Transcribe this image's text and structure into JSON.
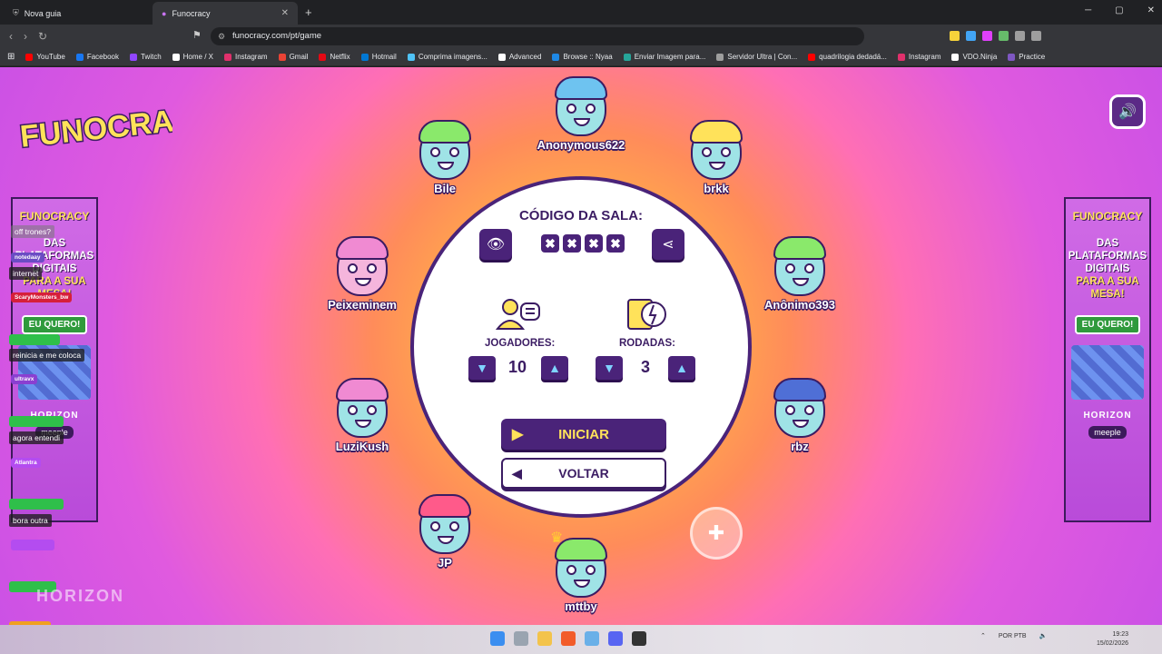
{
  "browser": {
    "tabs": [
      {
        "title": "Nova guia"
      },
      {
        "title": "Funocracy"
      }
    ],
    "url": "funocracy.com/pt/game",
    "bookmarks": [
      "YouTube",
      "Facebook",
      "Twitch",
      "Home / X",
      "Instagram",
      "Gmail",
      "Netflix",
      "Hotmail",
      "Comprima imagens...",
      "Advanced",
      "Browse :: Nyaa",
      "Enviar Imagem para...",
      "Servidor Ultra | Con...",
      "quadrilogia dedadá...",
      "Instagram",
      "VDO.Ninja",
      "Practice"
    ]
  },
  "game": {
    "logo_text": "FUNOCRACY",
    "room_label": "CÓDIGO DA SALA:",
    "room_code": [
      "✖",
      "✖",
      "✖",
      "✖"
    ],
    "players_label": "JOGADORES:",
    "players_value": "10",
    "rounds_label": "RODADAS:",
    "rounds_value": "3",
    "start_label": "INICIAR",
    "back_label": "VOLTAR",
    "players": [
      {
        "name": "Anonymous622",
        "skin": "#9fe3e6",
        "hair": "#6ec3f0"
      },
      {
        "name": "brkk",
        "skin": "#9fe3e6",
        "hair": "#ffe25a"
      },
      {
        "name": "Anônimo393",
        "skin": "#9fe3e6",
        "hair": "#8ae96b"
      },
      {
        "name": "rbz",
        "skin": "#9fe3e6",
        "hair": "#4f6fd6"
      },
      {
        "name": "mttby",
        "skin": "#9fe3e6",
        "hair": "#8ae96b"
      },
      {
        "name": "JP",
        "skin": "#9fe3e6",
        "hair": "#ff5a8a"
      },
      {
        "name": "LuziKush",
        "skin": "#9fe3e6",
        "hair": "#f08ad2"
      },
      {
        "name": "Peixeminem",
        "skin": "#f5b5dc",
        "hair": "#f08ad2"
      },
      {
        "name": "Bile",
        "skin": "#9fe3e6",
        "hair": "#8ae96b"
      }
    ]
  },
  "ads": {
    "brand": "FUNOCRACY",
    "headline_1": "DAS PLATAFORMAS DIGITAIS",
    "headline_2": "PARA A SUA MESA!",
    "cta": "EU QUERO!",
    "footer_1": "HORIZON",
    "footer_2": "meeple"
  },
  "chat": {
    "messages": [
      {
        "user": "notedaay",
        "text": "internet",
        "color": "#6b4cc4"
      },
      {
        "user": "ScaryMonsters_bw",
        "text": "",
        "color": "#d61f3a"
      },
      {
        "user": "",
        "text": "reinicia e me coloca",
        "color": "#2fbf4a"
      },
      {
        "user": "ultravx",
        "text": "",
        "color": "#8a3fd1"
      },
      {
        "user": "",
        "text": "agora entendi",
        "color": "#2fbf4a"
      },
      {
        "user": "Atlantra",
        "text": "",
        "color": "#b44cf0"
      },
      {
        "user": "",
        "text": "bora outra",
        "color": "#2fbf4a"
      },
      {
        "user": "",
        "text": "",
        "color": "#b44cf0"
      },
      {
        "user": "",
        "text": "",
        "color": "#2fbf4a"
      },
      {
        "user": "",
        "text": "",
        "color": "#f0a020"
      }
    ],
    "overlay_text": "off trones?"
  },
  "taskbar": {
    "lang": "POR PTB",
    "time": "19:23",
    "date": "15/02/2026"
  },
  "colors": {
    "primary": "#4a2379",
    "accent": "#ffe25a",
    "link": "#7fd3ff"
  }
}
